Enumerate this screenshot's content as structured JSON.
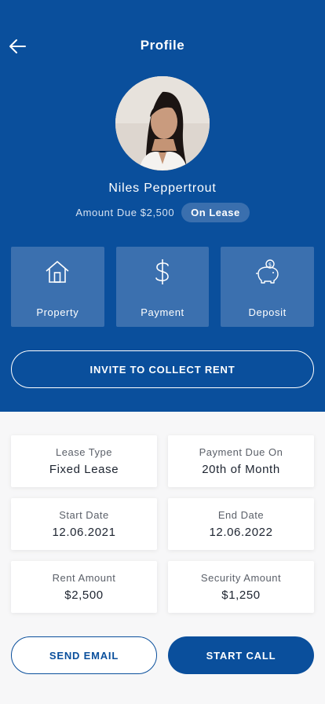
{
  "header": {
    "title": "Profile",
    "back_icon": "arrow-left-icon"
  },
  "profile": {
    "name": "Niles Peppertrout",
    "amount_due": "Amount Due $2,500",
    "status_badge": "On Lease"
  },
  "tiles": [
    {
      "label": "Property",
      "icon": "house-icon"
    },
    {
      "label": "Payment",
      "icon": "dollar-icon"
    },
    {
      "label": "Deposit",
      "icon": "piggy-bank-icon"
    }
  ],
  "invite_label": "INVITE TO COLLECT RENT",
  "details": [
    {
      "key": "Lease Type",
      "value": "Fixed Lease"
    },
    {
      "key": "Payment Due On",
      "value": "20th of Month"
    },
    {
      "key": "Start Date",
      "value": "12.06.2021"
    },
    {
      "key": "End Date",
      "value": "12.06.2022"
    },
    {
      "key": "Rent Amount",
      "value": "$2,500"
    },
    {
      "key": "Security Amount",
      "value": "$1,250"
    }
  ],
  "actions": {
    "email_label": "SEND EMAIL",
    "call_label": "START CALL"
  },
  "colors": {
    "primary": "#0a4f9c",
    "tile": "#3b70af",
    "badge": "#3a6fae",
    "background": "#f7f7f8"
  }
}
